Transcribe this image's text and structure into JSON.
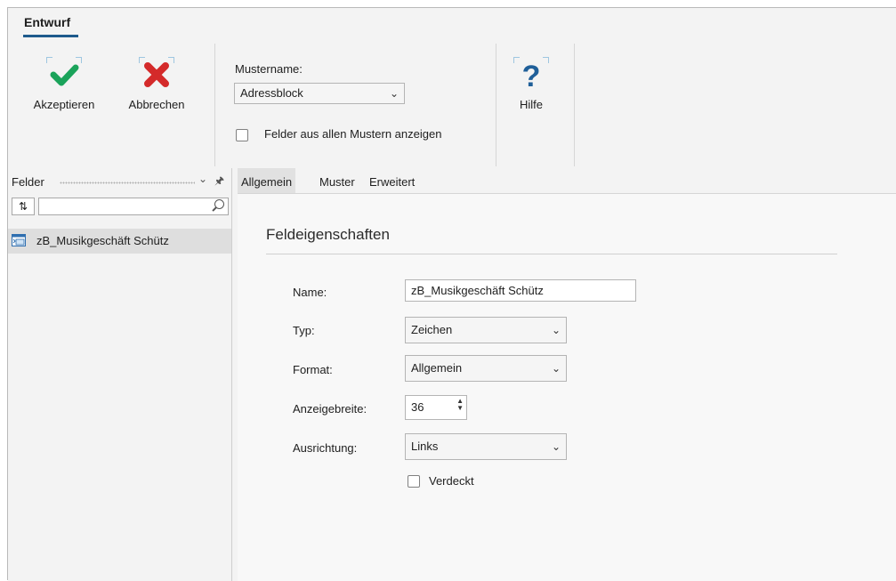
{
  "ribbon": {
    "tab_label": "Entwurf",
    "accept_label": "Akzeptieren",
    "cancel_label": "Abbrechen",
    "help_label": "Hilfe",
    "mustername_label": "Mustername:",
    "mustername_value": "Adressblock",
    "show_all_label": "Felder aus allen Mustern anzeigen"
  },
  "left_panel": {
    "title": "Felder",
    "sort_button": "⇅",
    "items": [
      {
        "label": "zB_Musikgeschäft Schütz"
      }
    ]
  },
  "tabs": [
    "Allgemein",
    "Muster",
    "Erweitert"
  ],
  "properties": {
    "heading": "Feldeigenschaften",
    "name_label": "Name:",
    "name_value": "zB_Musikgeschäft Schütz",
    "typ_label": "Typ:",
    "typ_value": "Zeichen",
    "format_label": "Format:",
    "format_value": "Allgemein",
    "anzeigebreite_label": "Anzeigebreite:",
    "anzeigebreite_value": "36",
    "ausrichtung_label": "Ausrichtung:",
    "ausrichtung_value": "Links",
    "verdeckt_label": "Verdeckt"
  },
  "colors": {
    "accept_green": "#1aa35a",
    "cancel_red": "#d42a2a",
    "help_blue": "#1f5f99",
    "tab_accent": "#1e5a8c"
  },
  "icons": [
    "checkmark-icon",
    "x-icon",
    "question-icon",
    "pin-icon",
    "chevron-down-icon",
    "search-icon",
    "field-icon"
  ]
}
